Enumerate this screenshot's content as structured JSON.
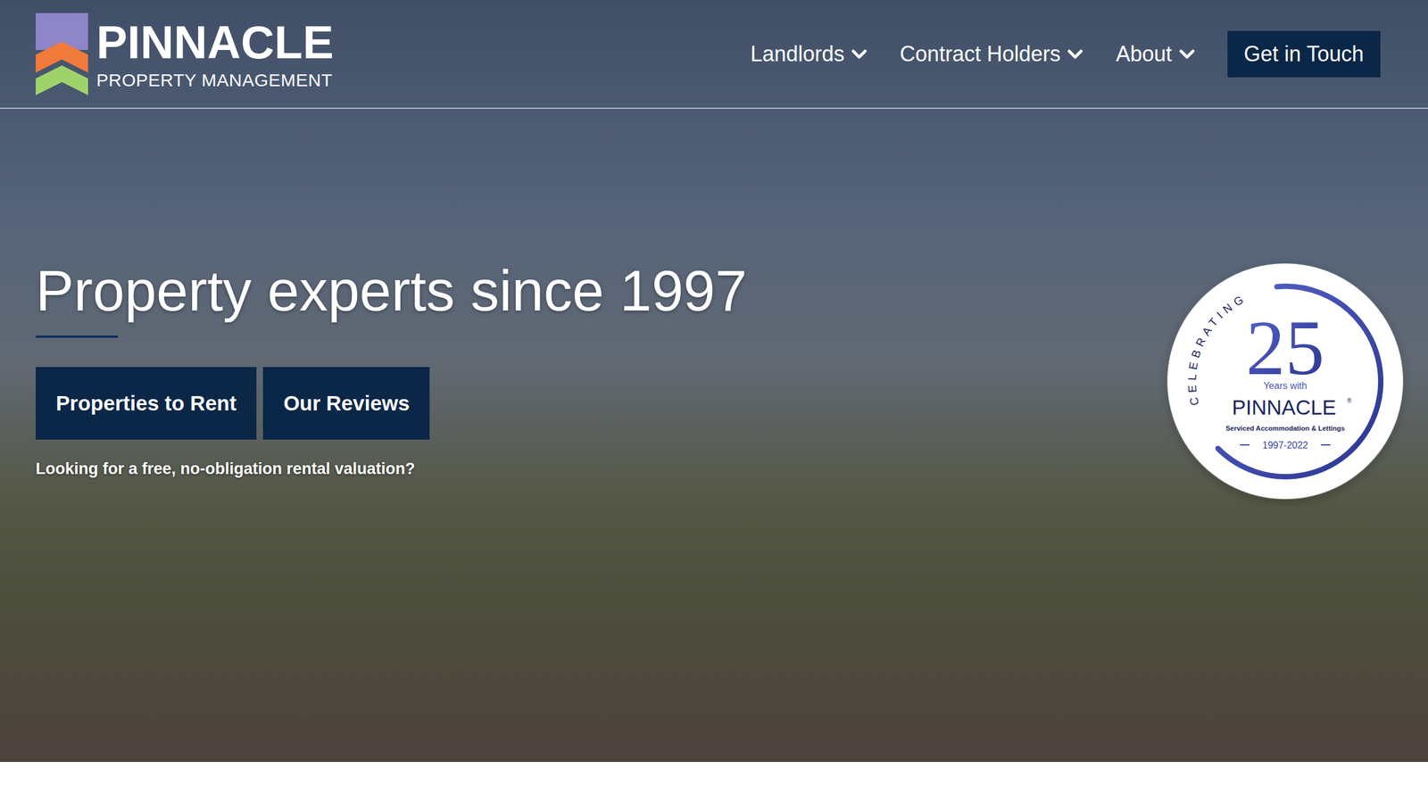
{
  "logo": {
    "name": "PINNACLE",
    "tagline": "PROPERTY MANAGEMENT"
  },
  "nav": [
    {
      "label": "Landlords",
      "has_dropdown": true
    },
    {
      "label": "Contract Holders",
      "has_dropdown": true
    },
    {
      "label": "About",
      "has_dropdown": true
    }
  ],
  "cta": "Get in Touch",
  "hero": {
    "title": "Property experts since 1997",
    "buttons": [
      "Properties to Rent",
      "Our Reviews"
    ],
    "subtext": "Looking for a free, no-obligation rental valuation?"
  },
  "badge": {
    "arc_text": "CELEBRATING",
    "number": "25",
    "caption": "Years with",
    "brand": "PINNACLE",
    "brand_mark": "®",
    "subtitle": "Serviced Accommodation & Lettings",
    "years": "1997-2022"
  }
}
